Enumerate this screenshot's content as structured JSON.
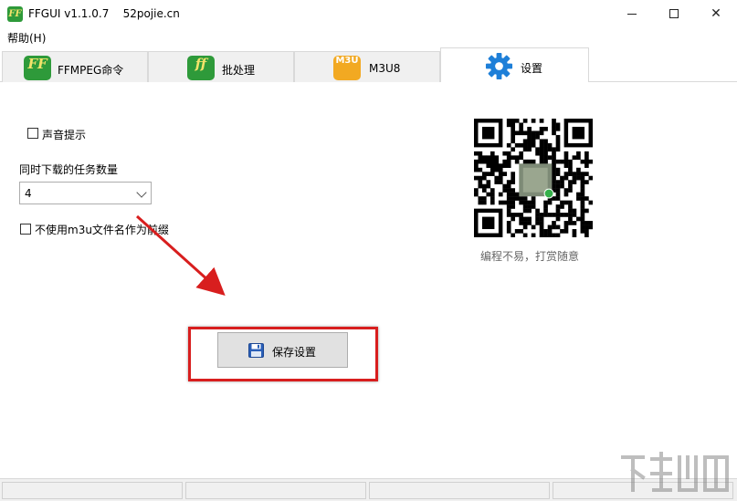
{
  "window": {
    "title": "FFGUI v1.1.0.7    52pojie.cn",
    "app_icon_glyph": "FF",
    "minimize_label": "Minimize",
    "maximize_label": "Maximize",
    "close_glyph": "✕"
  },
  "menu": {
    "items": [
      {
        "label": "帮助(H)"
      }
    ]
  },
  "tabs": [
    {
      "label": "FFMPEG命令",
      "icon_text": "FF",
      "icon": "ff-logo-icon",
      "color": "#2e9a3a"
    },
    {
      "label": "批处理",
      "icon_text": "ff",
      "icon": "ff-logo-icon",
      "color": "#2e9a3a"
    },
    {
      "label": "M3U8",
      "icon_text": "M3U",
      "icon": "m3u-icon",
      "color": "#f2a922"
    },
    {
      "label": "设置",
      "icon": "gear-icon",
      "color": "#1e7fd8",
      "active": true
    }
  ],
  "settings": {
    "sound_prompt": {
      "label": "声音提示",
      "checked": false
    },
    "concurrent_tasks": {
      "label": "同时下载的任务数量",
      "value": "4"
    },
    "no_m3u_prefix": {
      "label": "不使用m3u文件名作为前缀",
      "checked": false
    },
    "qr_caption": "编程不易，打赏随意",
    "save_button": {
      "label": "保存设置",
      "icon": "floppy-disk-icon"
    }
  },
  "annotation": {
    "highlight_color": "#d81e1e",
    "arrow_color": "#d81e1e"
  }
}
